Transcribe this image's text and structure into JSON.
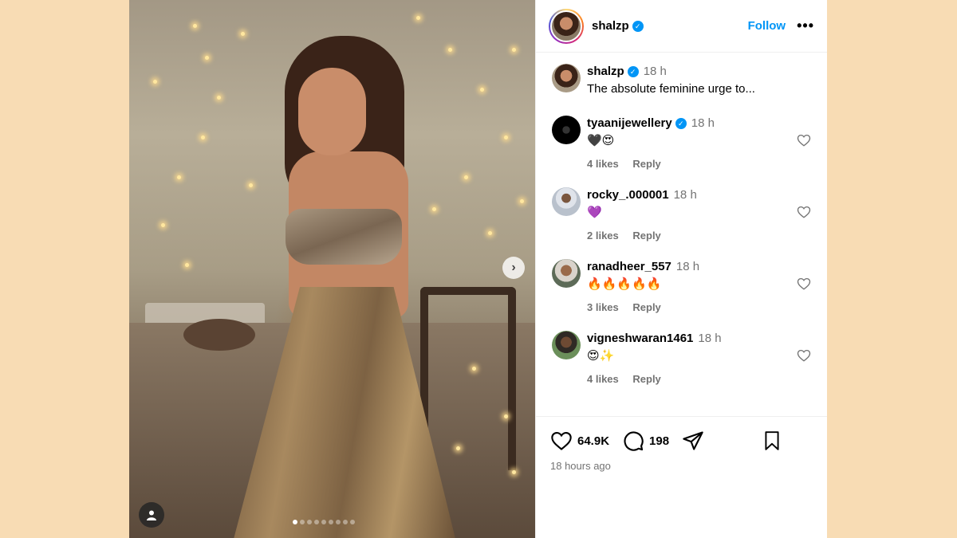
{
  "post": {
    "author": {
      "username": "shalzp",
      "verified": true,
      "follow_label": "Follow",
      "more_label": "•••"
    },
    "caption": {
      "username": "shalzp",
      "time": "18 h",
      "text": "The absolute feminine urge to..."
    },
    "comments": [
      {
        "username": "tyaanijewellery",
        "verified": true,
        "time": "18 h",
        "text": "🖤😍",
        "likes": "4 likes",
        "reply_label": "Reply"
      },
      {
        "username": "rocky_.000001",
        "verified": false,
        "time": "18 h",
        "text": "💜",
        "likes": "2 likes",
        "reply_label": "Reply"
      },
      {
        "username": "ranadheer_557",
        "verified": false,
        "time": "18 h",
        "text": "🔥🔥🔥🔥🔥",
        "likes": "3 likes",
        "reply_label": "Reply"
      },
      {
        "username": "vigneshwaran1461",
        "verified": false,
        "time": "18 h",
        "text": "😍✨",
        "likes": "4 likes",
        "reply_label": "Reply"
      }
    ],
    "actions": {
      "like_count": "64.9K",
      "comment_count": "198",
      "time_ago": "18 hours ago"
    },
    "carousel": {
      "total": 9,
      "active_index": 0,
      "next_label": "›"
    },
    "colors": {
      "accent": "#0095f6",
      "background": "#f8dcb4",
      "muted": "#737373"
    }
  }
}
